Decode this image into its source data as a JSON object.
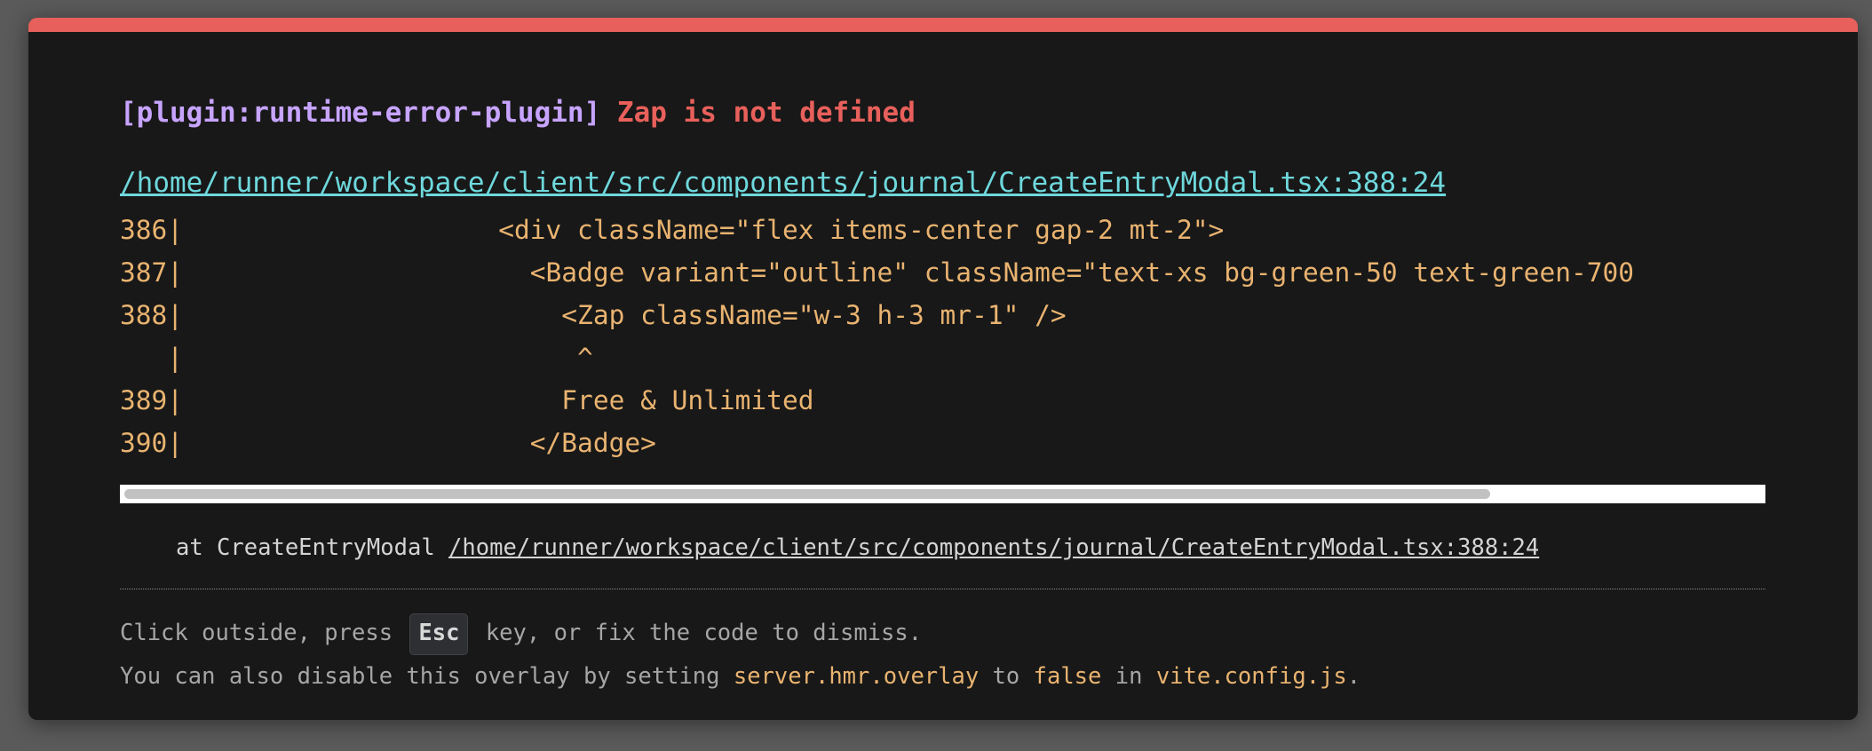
{
  "error": {
    "plugin": "[plugin:runtime-error-plugin]",
    "message": "Zap is not defined",
    "file": "/home/runner/workspace/client/src/components/journal/CreateEntryModal.tsx:388:24"
  },
  "code_frame": [
    "386|                    <div className=\"flex items-center gap-2 mt-2\">",
    "387|                      <Badge variant=\"outline\" className=\"text-xs bg-green-50 text-green-700",
    "388|                        <Zap className=\"w-3 h-3 mr-1\" />",
    "   |                         ^",
    "389|                        Free & Unlimited",
    "390|                      </Badge>"
  ],
  "stack": {
    "prefix": "at CreateEntryModal ",
    "file": "/home/runner/workspace/client/src/components/journal/CreateEntryModal.tsx:388:24"
  },
  "tip": {
    "line1_before": "Click outside, press ",
    "key": "Esc",
    "line1_after": " key, or fix the code to dismiss.",
    "line2_a": "You can also disable this overlay by setting ",
    "line2_setting": "server.hmr.overlay",
    "line2_b": " to ",
    "line2_value": "false",
    "line2_c": " in ",
    "line2_file": "vite.config.js",
    "line2_d": "."
  },
  "colors": {
    "accent_border": "#e8605b",
    "plugin": "#c7a4ff",
    "error": "#e8605b",
    "link": "#6ed8dc",
    "code": "#e9b370",
    "background": "#181818"
  }
}
